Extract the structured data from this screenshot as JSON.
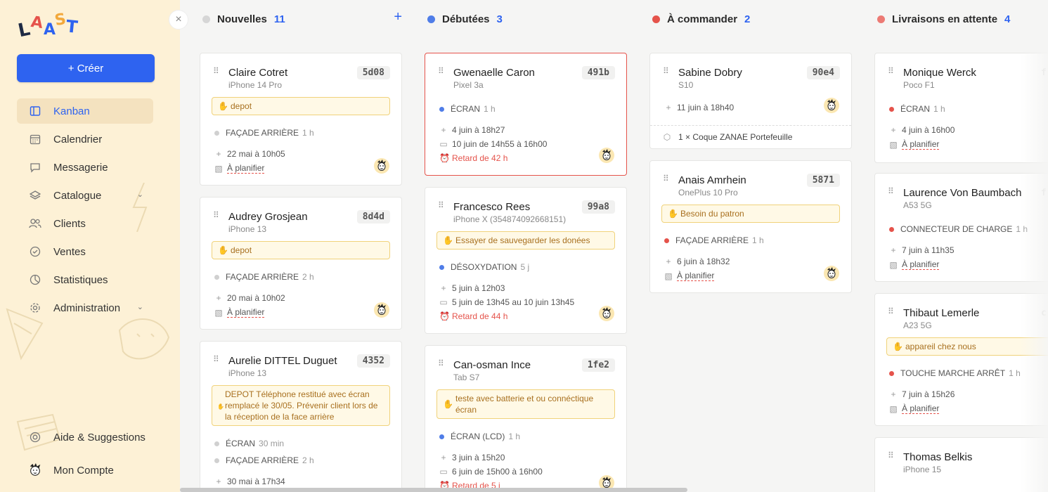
{
  "app": {
    "logo_letters": [
      "L",
      "A",
      "A",
      "S",
      "T"
    ],
    "accent": "#2e63f0"
  },
  "sidebar": {
    "create_label": "+ Créer",
    "close_label": "×",
    "items": [
      {
        "label": "Kanban",
        "icon": "kanban-icon",
        "active": true
      },
      {
        "label": "Calendrier",
        "icon": "calendar-icon"
      },
      {
        "label": "Messagerie",
        "icon": "message-icon"
      },
      {
        "label": "Catalogue",
        "icon": "layers-icon",
        "chevron": true
      },
      {
        "label": "Clients",
        "icon": "users-icon"
      },
      {
        "label": "Ventes",
        "icon": "badge-check-icon"
      },
      {
        "label": "Statistiques",
        "icon": "chart-pie-icon"
      },
      {
        "label": "Administration",
        "icon": "gear-icon",
        "chevron": true
      }
    ],
    "bottom": [
      {
        "label": "Aide & Suggestions",
        "icon": "lifebuoy-icon"
      },
      {
        "label": "Mon Compte",
        "icon": "avatar-icon"
      }
    ]
  },
  "columns": [
    {
      "title": "Nouvelles",
      "count": "11",
      "dot_color": "#d6d6d6"
    },
    {
      "title": "Débutées",
      "count": "3",
      "dot_color": "#4f7de8"
    },
    {
      "title": "À commander",
      "count": "2",
      "dot_color": "#e5534b"
    },
    {
      "title": "Livraisons en attente",
      "count": "4",
      "dot_color": "#ec7a74"
    }
  ],
  "cards": {
    "c1": {
      "name": "Claire Cotret",
      "model": "iPhone 14 Pro",
      "tag": "5d08",
      "note": "depot",
      "repair": "FAÇADE ARRIÈRE",
      "repair_dur": "1 h",
      "created": "22 mai à 10h05",
      "plan": "À planifier"
    },
    "c2": {
      "name": "Audrey Grosjean",
      "model": "iPhone 13",
      "tag": "8d4d",
      "note": "depot",
      "repair": "FAÇADE ARRIÈRE",
      "repair_dur": "2 h",
      "created": "20 mai à 10h02",
      "plan": "À planifier"
    },
    "c3": {
      "name": "Aurelie DITTEL Duguet",
      "model": "iPhone 13",
      "tag": "4352",
      "note": "DEPOT Téléphone restitué avec écran remplacé le 30/05. Prévenir client lors de la réception de la face arrière",
      "repair": "ÉCRAN",
      "repair_dur": "30 min",
      "repair2": "FAÇADE ARRIÈRE",
      "repair2_dur": "2 h",
      "created": "30 mai à 17h34"
    },
    "d1": {
      "name": "Gwenaelle Caron",
      "model": "Pixel 3a",
      "tag": "491b",
      "repair": "ÉCRAN",
      "repair_dur": "1 h",
      "created": "4 juin à 18h27",
      "sched": "10 juin de 14h55 à 16h00",
      "late": "Retard de 42 h"
    },
    "d2": {
      "name": "Francesco Rees",
      "model": "iPhone X (354874092668151)",
      "tag": "99a8",
      "note": "Essayer de sauvegarder les donées",
      "repair": "DÉSOXYDATION",
      "repair_dur": "5 j",
      "created": "5 juin à 12h03",
      "sched": "5 juin de 13h45 au 10 juin 13h45",
      "late": "Retard de 44 h"
    },
    "d3": {
      "name": "Can-osman Ince",
      "model": "Tab S7",
      "tag": "1fe2",
      "note": "teste avec batterie et ou connéctique écran",
      "repair": "ÉCRAN (LCD)",
      "repair_dur": "1 h",
      "created": "3 juin à 15h20",
      "sched": "6 juin de 15h00 à 16h00",
      "late": "Retard de 5 j"
    },
    "o1": {
      "name": "Sabine Dobry",
      "model": "S10",
      "tag": "90e4",
      "created": "11 juin à 18h40",
      "extra": "1 × Coque ZANAE Portefeuille"
    },
    "o2": {
      "name": "Anais Amrhein",
      "model": "OnePlus 10 Pro",
      "tag": "5871",
      "note": "Besoin du patron",
      "repair": "FAÇADE ARRIÈRE",
      "repair_dur": "1 h",
      "created": "6 juin à 18h32",
      "plan": "À planifier"
    },
    "l1": {
      "name": "Monique Werck",
      "model": "Poco F1",
      "tag": "f",
      "repair": "ÉCRAN",
      "repair_dur": "1 h",
      "created": "4 juin à 16h00",
      "plan": "À planifier"
    },
    "l2": {
      "name": "Laurence Von Baumbach",
      "model": "A53 5G",
      "tag": "f",
      "repair": "CONNECTEUR DE CHARGE",
      "repair_dur": "1 h",
      "created": "7 juin à 11h35",
      "plan": "À planifier"
    },
    "l3": {
      "name": "Thibaut Lemerle",
      "model": "A23 5G",
      "tag": "c",
      "note": "appareil chez nous",
      "repair": "TOUCHE MARCHE ARRÊT",
      "repair_dur": "1 h",
      "created": "7 juin à 15h26",
      "plan": "À planifier"
    },
    "l4": {
      "name": "Thomas Belkis",
      "model": "iPhone 15"
    }
  }
}
